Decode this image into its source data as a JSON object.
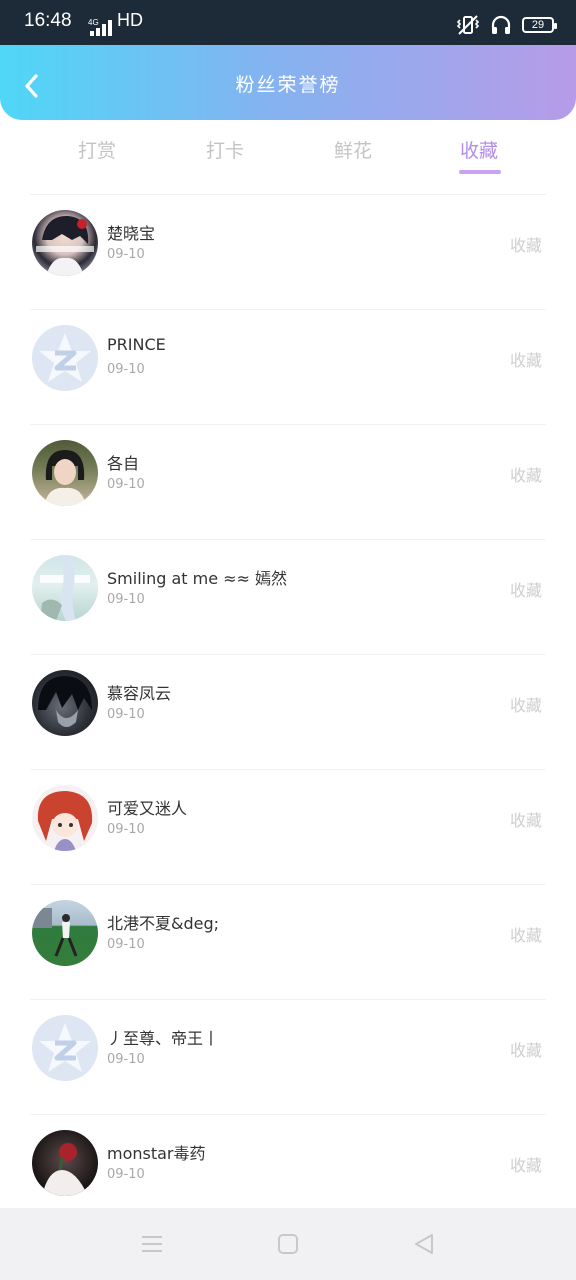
{
  "status_bar": {
    "time": "16:48",
    "network": "4G",
    "hd": "HD",
    "battery": "29"
  },
  "header": {
    "title": "粉丝荣誉榜"
  },
  "tabs": [
    {
      "label": "打赏"
    },
    {
      "label": "打卡"
    },
    {
      "label": "鲜花"
    },
    {
      "label": "收藏"
    }
  ],
  "active_tab": "收藏",
  "list": [
    {
      "name": "楚晓宝",
      "date": "09-10",
      "action": "收藏",
      "avatar": "anime-boy"
    },
    {
      "name": "PRINCE",
      "date": "09-10",
      "action": "收藏",
      "avatar": "default-z"
    },
    {
      "name": "各自",
      "date": "09-10",
      "action": "收藏",
      "avatar": "girl-photo"
    },
    {
      "name": "Smiling at me ≈≈ 嫣然",
      "date": "09-10",
      "action": "收藏",
      "avatar": "pastel-photo"
    },
    {
      "name": "慕容凤云",
      "date": "09-10",
      "action": "收藏",
      "avatar": "dark-anime"
    },
    {
      "name": "可爱又迷人",
      "date": "09-10",
      "action": "收藏",
      "avatar": "red-hair-anime"
    },
    {
      "name": "北港不夏&deg;",
      "date": "09-10",
      "action": "收藏",
      "avatar": "outdoor-photo"
    },
    {
      "name": "丿至尊、帝王丨",
      "date": "09-10",
      "action": "收藏",
      "avatar": "default-z"
    },
    {
      "name": "monstar毒药",
      "date": "09-10",
      "action": "收藏",
      "avatar": "rose-photo"
    }
  ],
  "colors": {
    "accent": "#b48de6",
    "header_start": "#4fd7f7",
    "header_end": "#b79be8"
  }
}
